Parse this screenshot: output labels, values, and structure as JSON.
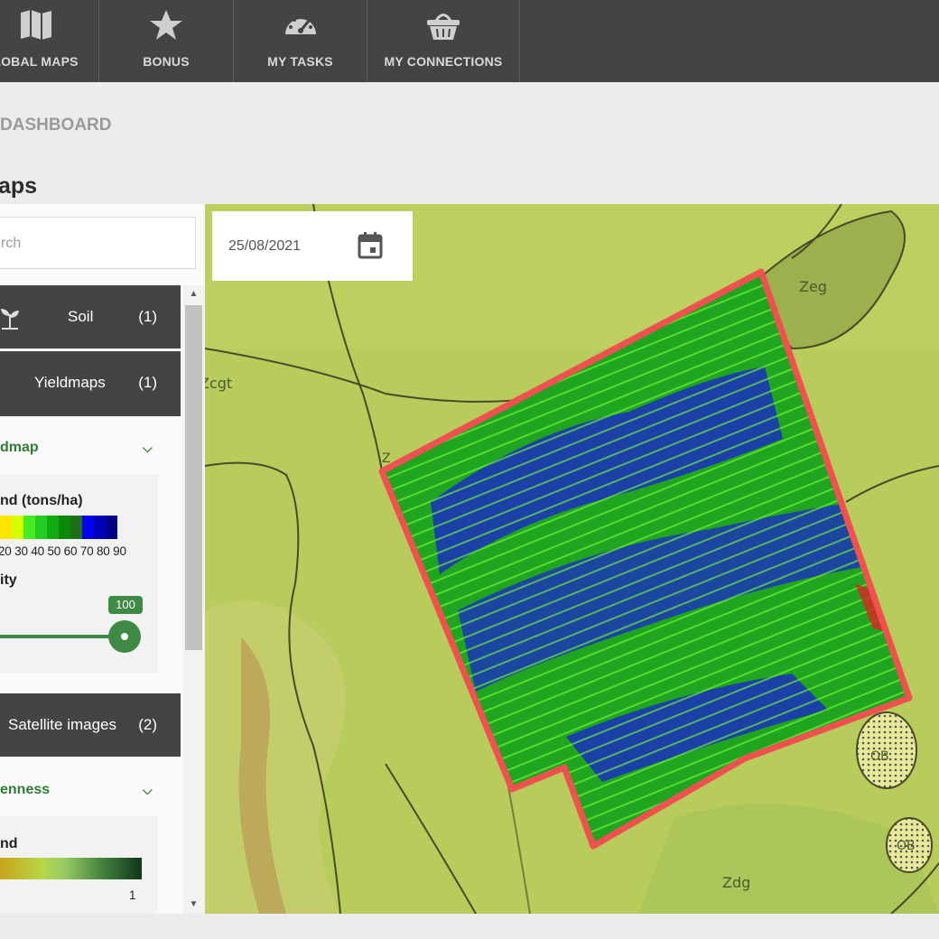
{
  "nav": {
    "items": [
      {
        "label": "LOBAL MAPS",
        "icon": "map-icon"
      },
      {
        "label": "BONUS",
        "icon": "star-icon"
      },
      {
        "label": "MY TASKS",
        "icon": "gauge-icon"
      },
      {
        "label": "MY CONNECTIONS",
        "icon": "basket-icon"
      }
    ]
  },
  "breadcrumb": "DASHBOARD",
  "page_title": "aps",
  "search": {
    "placeholder": "rch"
  },
  "categories": [
    {
      "name": "Soil",
      "count": "(1)",
      "icon": "sprout-icon"
    },
    {
      "name": "Yieldmaps",
      "count": "(1)"
    },
    {
      "name": "Satellite images",
      "count": "(2)"
    }
  ],
  "yieldmap": {
    "title": "dmap",
    "legend_title": "nd (tons/ha)",
    "ticks": "20 30 40 50 60 70 80 90",
    "colors": [
      "#ffe600",
      "#d4ff00",
      "#44ee22",
      "#22cc22",
      "#11aa11",
      "#0a8a0a",
      "#1f6e1a",
      "#0000ee",
      "#0000bb",
      "#000088"
    ],
    "opacity_label": "ity",
    "opacity_value": "100",
    "opacity_fraction": 1.0
  },
  "greenness": {
    "title": "enness",
    "legend_title": "nd",
    "end_tick": "1"
  },
  "map": {
    "date": "25/08/2021",
    "labels": [
      "Zeg",
      "Zcgt",
      "Zdg",
      "OB",
      "OB",
      "Z"
    ]
  }
}
